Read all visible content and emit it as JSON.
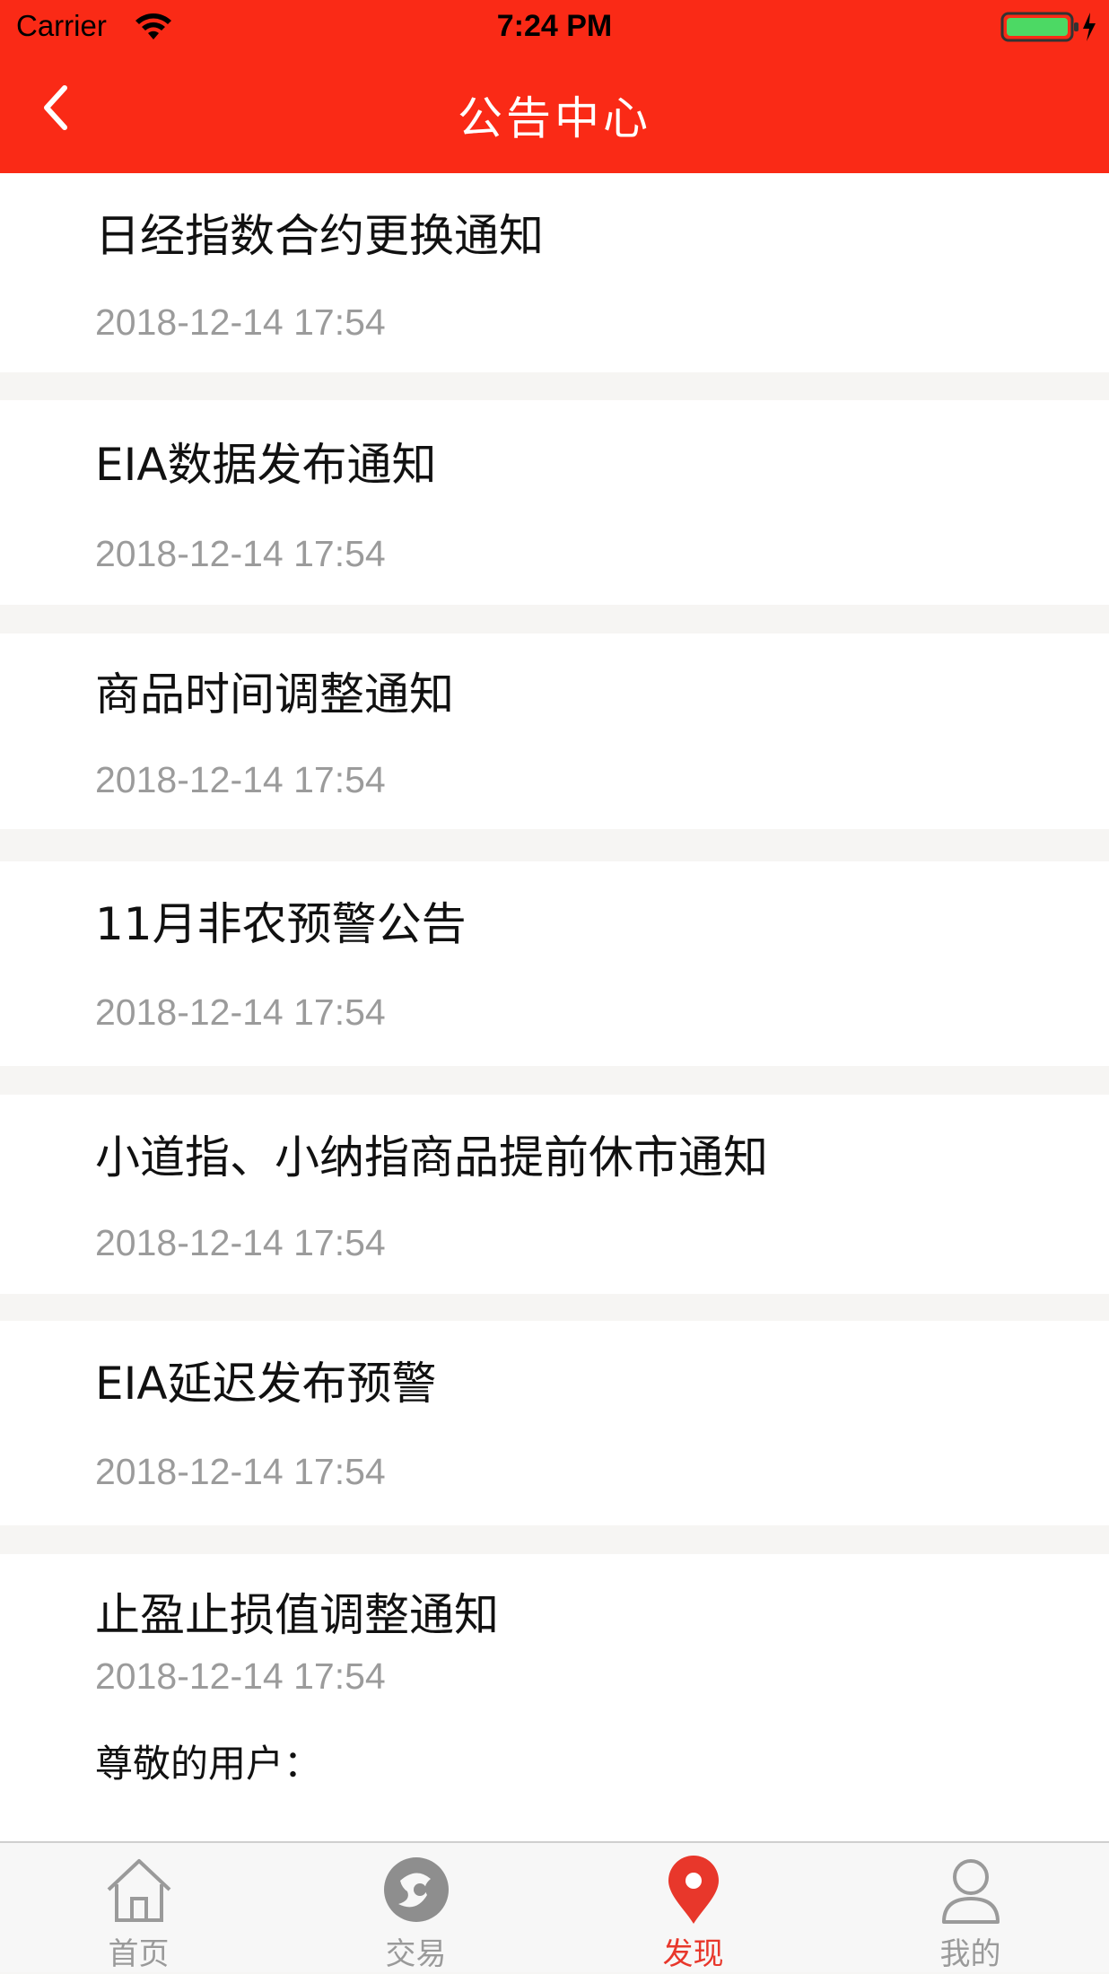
{
  "status_bar": {
    "carrier": "Carrier",
    "time": "7:24 PM",
    "battery_color": "#4cd964"
  },
  "nav": {
    "title": "公告中心",
    "back_icon": "chevron-left-icon",
    "bar_color": "#fa2a16"
  },
  "notices": [
    {
      "title": "日经指数合约更换通知",
      "date": "2018-12-14 17:54"
    },
    {
      "title": "EIA数据发布通知",
      "date": "2018-12-14 17:54"
    },
    {
      "title": "商品时间调整通知",
      "date": "2018-12-14 17:54"
    },
    {
      "title": "11月非农预警公告",
      "date": "2018-12-14 17:54"
    },
    {
      "title": "小道指、小纳指商品提前休市通知",
      "date": "2018-12-14 17:54"
    },
    {
      "title": "EIA延迟发布预警",
      "date": "2018-12-14 17:54"
    },
    {
      "title": "止盈止损值调整通知",
      "date": "2018-12-14 17:54",
      "body": "尊敬的用户："
    }
  ],
  "tabbar": {
    "active_color": "#e8372b",
    "inactive_color": "#9a9a9a",
    "tabs": [
      {
        "label": "首页",
        "icon": "home-icon"
      },
      {
        "label": "交易",
        "icon": "trade-icon"
      },
      {
        "label": "发现",
        "icon": "location-pin-icon",
        "active": true
      },
      {
        "label": "我的",
        "icon": "user-icon"
      }
    ]
  }
}
